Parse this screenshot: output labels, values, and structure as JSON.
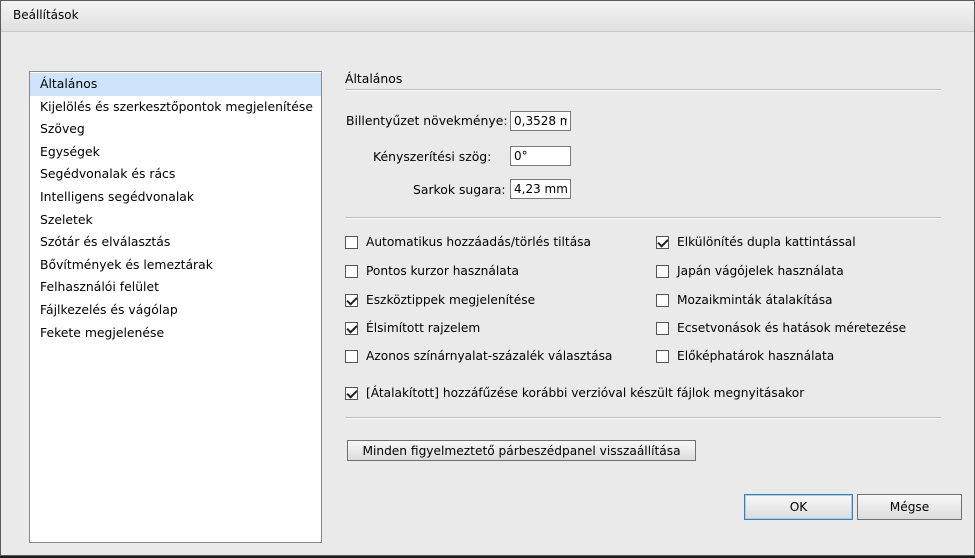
{
  "window": {
    "title": "Beállítások"
  },
  "categories": [
    "Általános",
    "Kijelölés és szerkesztőpontok megjelenítése",
    "Szöveg",
    "Egységek",
    "Segédvonalak és rács",
    "Intelligens segédvonalak",
    "Szeletek",
    "Szótár és elválasztás",
    "Bővítmények és lemeztárak",
    "Felhasználói felület",
    "Fájlkezelés és vágólap",
    "Fekete megjelenése"
  ],
  "selected_category": "Általános",
  "section": {
    "title": "Általános"
  },
  "fields": {
    "keyboard_increment": {
      "label": "Billentyűzet növekménye:",
      "value": "0,3528 m"
    },
    "constrain_angle": {
      "label": "Kényszerítési szög:",
      "value": "0°"
    },
    "corner_radius": {
      "label": "Sarkok sugara:",
      "value": "4,23 mm"
    }
  },
  "checkboxes_left": [
    {
      "label": "Automatikus hozzáadás/törlés tiltása",
      "checked": false
    },
    {
      "label": "Pontos kurzor használata",
      "checked": false
    },
    {
      "label": "Eszköztippek megjelenítése",
      "checked": true
    },
    {
      "label": "Élsimított rajzelem",
      "checked": true
    },
    {
      "label": "Azonos színárnyalat-százalék választása",
      "checked": false
    }
  ],
  "checkboxes_right": [
    {
      "label": "Elkülönítés dupla kattintással",
      "checked": true
    },
    {
      "label": "Japán vágójelek használata",
      "checked": false
    },
    {
      "label": "Mozaikminták átalakítása",
      "checked": false
    },
    {
      "label": "Ecsetvonások és hatások méretezése",
      "checked": false
    },
    {
      "label": "Előképhatárok használata",
      "checked": false
    }
  ],
  "checkbox_wide": {
    "label": "[Átalakított] hozzáfűzése korábbi verzióval készült fájlok megnyitásakor",
    "checked": true
  },
  "buttons": {
    "reset_warnings": "Minden figyelmeztető párbeszédpanel visszaállítása",
    "ok": "OK",
    "cancel": "Mégse"
  },
  "colors": {
    "selection": "#cde4fb",
    "dialog_bg": "#eaeaea"
  }
}
